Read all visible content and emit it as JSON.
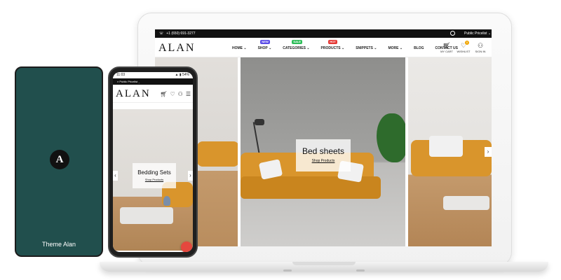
{
  "laptop": {
    "topbar": {
      "phone": "+1 (650) 691-3277",
      "pricelist": "Public Pricelist ⌄"
    },
    "logo": "ALAN",
    "nav": [
      {
        "label": "HOME ⌄",
        "badge": "",
        "badge_color": ""
      },
      {
        "label": "SHOP ⌄",
        "badge": "NEW",
        "badge_color": "#5b4de8"
      },
      {
        "label": "CATEGORIES ⌄",
        "badge": "SALE",
        "badge_color": "#2ebd59"
      },
      {
        "label": "PRODUCTS ⌄",
        "badge": "HOT",
        "badge_color": "#e53935"
      },
      {
        "label": "SNIPPETS ⌄",
        "badge": "",
        "badge_color": ""
      },
      {
        "label": "MORE ⌄",
        "badge": "",
        "badge_color": ""
      },
      {
        "label": "BLOG",
        "badge": "",
        "badge_color": ""
      },
      {
        "label": "CONTACT US",
        "badge": "",
        "badge_color": ""
      }
    ],
    "header_icons": [
      {
        "label": "MY CART",
        "icon": "cart-icon",
        "count": ""
      },
      {
        "label": "WISHLIST",
        "icon": "heart-icon",
        "count": "0"
      },
      {
        "label": "SIGN IN",
        "icon": "user-icon",
        "count": ""
      }
    ],
    "hero": {
      "title": "Bed sheets",
      "link": "Shop Products"
    }
  },
  "phone": {
    "status_time": "11:03",
    "status_right": "▲ ▮ 54%",
    "pricelist": "Public Pricelist ⌄",
    "logo": "ALAN",
    "wishlist_count": "0",
    "hero": {
      "title": "Bedding Sets",
      "link": "Shop Products"
    }
  },
  "card": {
    "logo_letter": "A",
    "title": "Theme Alan"
  },
  "colors": {
    "card_bg": "#214f4d",
    "accent": "#d9952c",
    "chat": "#e5483e"
  }
}
